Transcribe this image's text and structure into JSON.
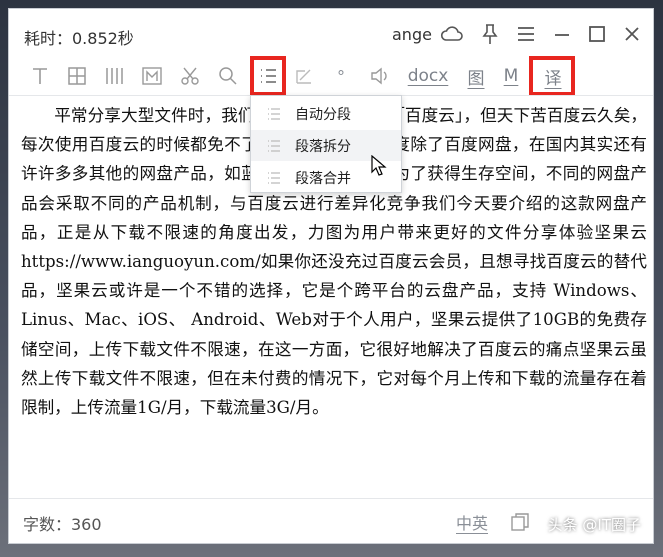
{
  "titlebar": {
    "title": "耗时：0.852秒",
    "user": "ange"
  },
  "toolbar": {
    "docx": "docx",
    "image": "图",
    "markdown": "M",
    "translate": "译",
    "degree": "°"
  },
  "menu": {
    "items": [
      {
        "label": "自动分段"
      },
      {
        "label": "段落拆分"
      },
      {
        "label": "段落合并"
      }
    ]
  },
  "content": {
    "text": "平常分享大型文件时，我们第一个想到的都是「百度云」，但天下苦百度云久矣，每次使用百度云的时候都免不了会吐槽它的下载速度除了百度网盘，在国内其实还有许许多多其他的网盘产品，如蓝奏云、和彩云等，为了获得生存空间，不同的网盘产品会采取不同的产品机制，与百度云进行差异化竞争我们今天要介绍的这款网盘产品，正是从下载不限速的角度出发，力图为用户带来更好的文件分享体验坚果云https://www.ianguoyun.com/如果你还没充过百度云会员，且想寻找百度云的替代品，坚果云或许是一个不错的选择，它是个跨平台的云盘产品，支持 Windows、 Linus、Mac、iOS、 Android、Web对于个人用户，坚果云提供了10GB的免费存储空间，上传下载文件不限速，在这一方面，它很好地解决了百度云的痛点坚果云虽然上传下载文件不限速，但在未付费的情况下，它对每个月上传和下载的流量存在着限制，上传流量1G/月，下载流量3G/月。"
  },
  "statusbar": {
    "word_count": "字数：360",
    "ime": "中英",
    "watermark": "头条 @IT圈子"
  }
}
